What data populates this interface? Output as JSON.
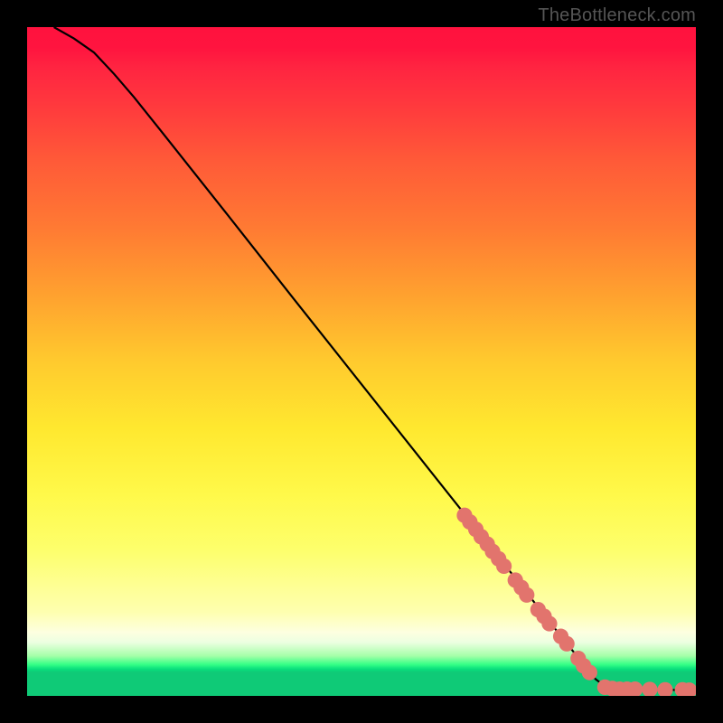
{
  "watermark": "TheBottleneck.com",
  "chart_data": {
    "type": "line",
    "title": "",
    "xlabel": "",
    "ylabel": "",
    "xlim": [
      0,
      100
    ],
    "ylim": [
      0,
      100
    ],
    "grid": false,
    "legend": false,
    "curve": [
      {
        "x": 4,
        "y": 100
      },
      {
        "x": 7,
        "y": 98.3
      },
      {
        "x": 10,
        "y": 96.2
      },
      {
        "x": 13,
        "y": 93.0
      },
      {
        "x": 16,
        "y": 89.5
      },
      {
        "x": 20,
        "y": 84.5
      },
      {
        "x": 30,
        "y": 71.9
      },
      {
        "x": 40,
        "y": 59.2
      },
      {
        "x": 50,
        "y": 46.6
      },
      {
        "x": 60,
        "y": 34.0
      },
      {
        "x": 70,
        "y": 21.4
      },
      {
        "x": 80,
        "y": 8.7
      },
      {
        "x": 85,
        "y": 2.5
      },
      {
        "x": 86.6,
        "y": 1.3
      },
      {
        "x": 88,
        "y": 1.0
      },
      {
        "x": 92,
        "y": 0.95
      },
      {
        "x": 96,
        "y": 0.9
      },
      {
        "x": 100,
        "y": 0.85
      }
    ],
    "points": [
      {
        "x": 65.4,
        "y": 27.0
      },
      {
        "x": 66.2,
        "y": 26.0
      },
      {
        "x": 67.1,
        "y": 24.9
      },
      {
        "x": 67.9,
        "y": 23.8
      },
      {
        "x": 68.8,
        "y": 22.7
      },
      {
        "x": 69.6,
        "y": 21.6
      },
      {
        "x": 70.5,
        "y": 20.5
      },
      {
        "x": 71.3,
        "y": 19.4
      },
      {
        "x": 73.0,
        "y": 17.3
      },
      {
        "x": 73.9,
        "y": 16.2
      },
      {
        "x": 74.7,
        "y": 15.1
      },
      {
        "x": 76.4,
        "y": 12.9
      },
      {
        "x": 77.3,
        "y": 11.9
      },
      {
        "x": 78.1,
        "y": 10.8
      },
      {
        "x": 79.8,
        "y": 8.9
      },
      {
        "x": 80.7,
        "y": 7.8
      },
      {
        "x": 82.4,
        "y": 5.6
      },
      {
        "x": 83.2,
        "y": 4.5
      },
      {
        "x": 84.1,
        "y": 3.5
      },
      {
        "x": 86.4,
        "y": 1.3
      },
      {
        "x": 87.5,
        "y": 1.1
      },
      {
        "x": 88.6,
        "y": 1.0
      },
      {
        "x": 89.7,
        "y": 1.0
      },
      {
        "x": 90.9,
        "y": 1.0
      },
      {
        "x": 93.1,
        "y": 0.95
      },
      {
        "x": 95.4,
        "y": 0.9
      },
      {
        "x": 98.0,
        "y": 0.9
      },
      {
        "x": 99.0,
        "y": 0.85
      }
    ],
    "point_color": "#e2746d",
    "line_color": "#000000"
  }
}
